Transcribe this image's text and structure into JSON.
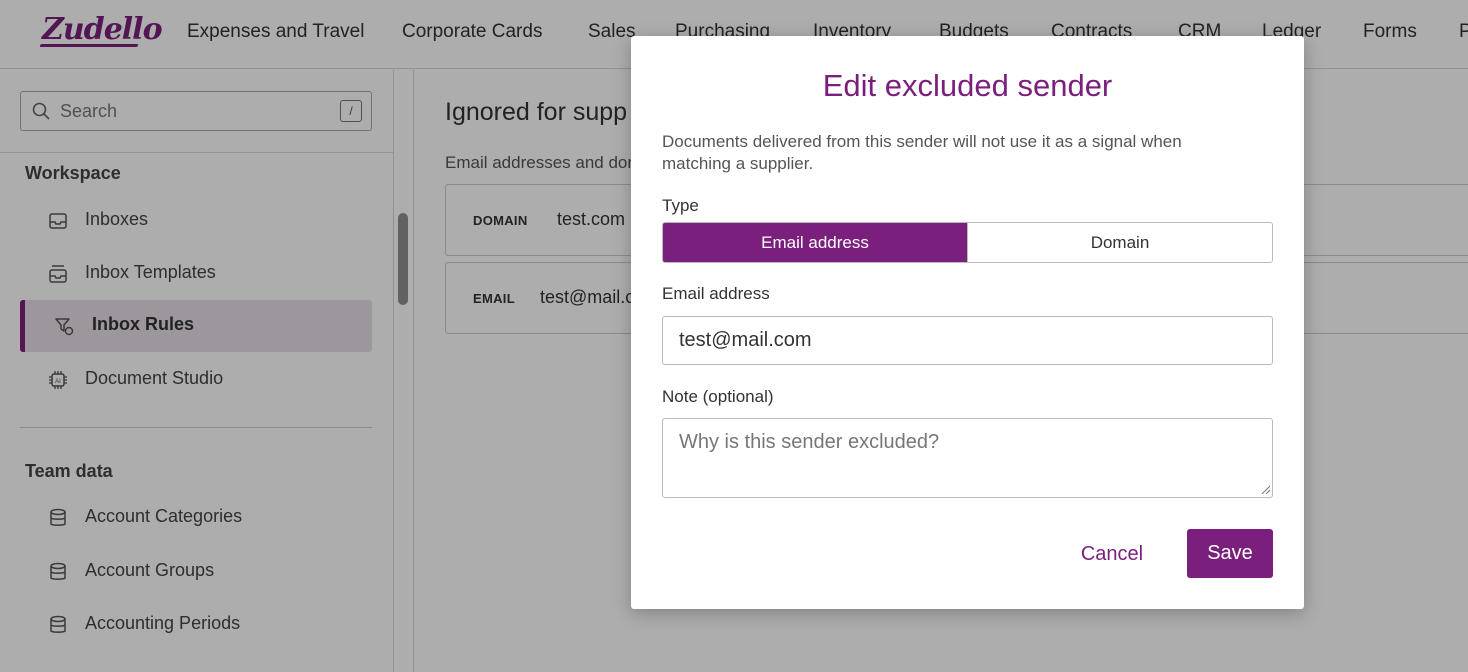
{
  "app": {
    "logo_text": "Zudello",
    "nav": [
      "Expenses and Travel",
      "Corporate Cards",
      "Sales",
      "Purchasing",
      "Inventory",
      "Budgets",
      "Contracts",
      "CRM",
      "Ledger",
      "Forms",
      "P"
    ]
  },
  "sidebar": {
    "search_placeholder": "Search",
    "search_shortcut": "/",
    "workspace_title": "Workspace",
    "workspace_items": [
      {
        "label": "Inboxes",
        "icon": "inbox-icon"
      },
      {
        "label": "Inbox Templates",
        "icon": "inbox-template-icon"
      },
      {
        "label": "Inbox Rules",
        "icon": "filter-rule-icon",
        "active": true
      },
      {
        "label": "Document Studio",
        "icon": "ai-chip-icon"
      }
    ],
    "team_title": "Team data",
    "team_items": [
      {
        "label": "Account Categories",
        "icon": "database-icon"
      },
      {
        "label": "Account Groups",
        "icon": "database-icon"
      },
      {
        "label": "Accounting Periods",
        "icon": "database-icon"
      }
    ]
  },
  "main": {
    "title": "Ignored for supp",
    "subtitle": "Email addresses and dor",
    "rows": [
      {
        "type": "DOMAIN",
        "value": "test.com"
      },
      {
        "type": "EMAIL",
        "value": "test@mail.c"
      }
    ]
  },
  "modal": {
    "title": "Edit excluded sender",
    "description": "Documents delivered from this sender will not use it as a signal when matching a supplier.",
    "type_label": "Type",
    "type_options": [
      "Email address",
      "Domain"
    ],
    "type_selected": "Email address",
    "email_label": "Email address",
    "email_value": "test@mail.com",
    "note_label": "Note (optional)",
    "note_placeholder": "Why is this sender excluded?",
    "cancel_label": "Cancel",
    "save_label": "Save"
  },
  "colors": {
    "brand": "#7b1f7c",
    "active_bg": "#e8dde8",
    "overlay": "rgba(0,0,0,0.32)"
  }
}
